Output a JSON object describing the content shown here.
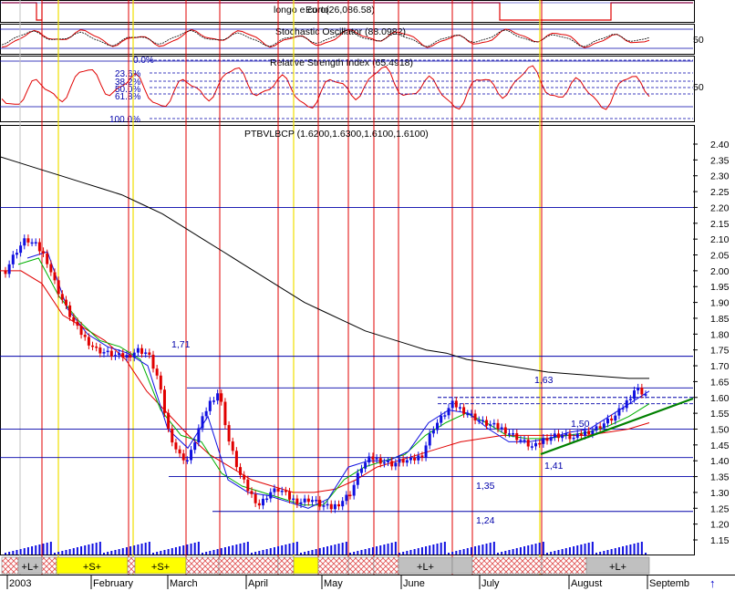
{
  "panels": {
    "top_label": "longo e corto",
    "top_label_overlay": "Euro(26,086.58)",
    "stoch_label": "Stochastic Oscillator (88.0982)",
    "stoch_tick": "50",
    "rsi_label": "Relative Strength Index (65.4918)",
    "rsi_tick": "50",
    "fib_levels": [
      "0.0%",
      "23.6%",
      "38.2%",
      "50.0%",
      "61.8%",
      "100.0%"
    ],
    "price_label": "PTBVLBCP (1.6200,1.6300,1.6100,1.6100)"
  },
  "annotations": {
    "a171": "1,71",
    "a163": "1,63",
    "a150": "1,50",
    "a141": "1,41",
    "a135": "1,35",
    "a124": "1,24"
  },
  "signals": [
    {
      "label": "+L+"
    },
    {
      "label": "+S+"
    },
    {
      "label": "+S+"
    },
    {
      "label": "+L+"
    },
    {
      "label": "+L+"
    }
  ],
  "month_labels": [
    "2003",
    "February",
    "March",
    "April",
    "May",
    "June",
    "July",
    "August",
    "Septemb"
  ],
  "colors": {
    "price_up": "#1010e0",
    "price_down": "#e00000",
    "ma_long": "#000000",
    "ma_red": "#e00000",
    "ma_green": "#00b000",
    "ma_blue": "#1010e0",
    "trend_green": "#008000",
    "gridline": "#0000aa",
    "signal_yellow": "#ffff00",
    "signal_grey": "#c0c0c0",
    "signal_hatch": "#ffb0b0",
    "arrow": "#0000cc"
  },
  "chart_data": {
    "type": "line",
    "title": "PTBVLBCP (1.6200,1.6300,1.6100,1.6100)",
    "ylim": [
      1.1,
      2.46
    ],
    "y_ticks": [
      "2.40",
      "2.35",
      "2.30",
      "2.25",
      "2.20",
      "2.15",
      "2.10",
      "2.05",
      "2.00",
      "1.95",
      "1.90",
      "1.85",
      "1.80",
      "1.75",
      "1.70",
      "1.65",
      "1.60",
      "1.55",
      "1.50",
      "1.45",
      "1.40",
      "1.35",
      "1.30",
      "1.25",
      "1.20",
      "1.15"
    ],
    "horizontal_levels": [
      2.2,
      1.73,
      1.63,
      1.6,
      1.58,
      1.5,
      1.41,
      1.35,
      1.24
    ],
    "series": [
      {
        "name": "PTBVLBCP",
        "values": [
          2.0,
          2.06,
          2.1,
          2.08,
          2.04,
          1.95,
          1.88,
          1.82,
          1.78,
          1.75,
          1.74,
          1.73,
          1.73,
          1.75,
          1.74,
          1.66,
          1.5,
          1.42,
          1.4,
          1.5,
          1.58,
          1.62,
          1.46,
          1.36,
          1.3,
          1.26,
          1.3,
          1.31,
          1.28,
          1.27,
          1.28,
          1.26,
          1.25,
          1.27,
          1.3,
          1.38,
          1.41,
          1.4,
          1.39,
          1.4,
          1.4,
          1.42,
          1.5,
          1.54,
          1.58,
          1.56,
          1.54,
          1.52,
          1.51,
          1.5,
          1.48,
          1.46,
          1.44,
          1.47,
          1.48,
          1.48,
          1.47,
          1.49,
          1.5,
          1.52,
          1.54,
          1.58,
          1.63,
          1.61
        ]
      },
      {
        "values": [
          2.36,
          2.34,
          2.32,
          2.3,
          2.28,
          2.26,
          2.24,
          2.21,
          2.18,
          2.14,
          2.1,
          2.06,
          2.02,
          1.98,
          1.94,
          1.9,
          1.87,
          1.84,
          1.81,
          1.79,
          1.77,
          1.75,
          1.74,
          1.72,
          1.71,
          1.7,
          1.69,
          1.68,
          1.675,
          1.67,
          1.665,
          1.66,
          1.66
        ]
      },
      {
        "values": [
          2.0,
          2.0,
          1.96,
          1.86,
          1.82,
          1.78,
          1.72,
          1.62,
          1.55,
          1.48,
          1.42,
          1.38,
          1.34,
          1.32,
          1.3,
          1.3,
          1.31,
          1.34,
          1.38,
          1.4,
          1.42,
          1.44,
          1.46,
          1.47,
          1.48,
          1.48,
          1.48,
          1.48,
          1.48,
          1.49,
          1.5,
          1.52
        ]
      },
      {
        "values": [
          2.02,
          2.04,
          1.92,
          1.84,
          1.78,
          1.76,
          1.72,
          1.56,
          1.48,
          1.46,
          1.36,
          1.32,
          1.3,
          1.28,
          1.26,
          1.26,
          1.34,
          1.38,
          1.4,
          1.42,
          1.48,
          1.52,
          1.55,
          1.52,
          1.48,
          1.47,
          1.47,
          1.48,
          1.49,
          1.51,
          1.54,
          1.58
        ]
      },
      {
        "values": [
          2.04,
          2.06,
          1.88,
          1.8,
          1.76,
          1.74,
          1.7,
          1.5,
          1.44,
          1.54,
          1.34,
          1.3,
          1.29,
          1.27,
          1.25,
          1.28,
          1.38,
          1.4,
          1.4,
          1.43,
          1.52,
          1.56,
          1.55,
          1.5,
          1.46,
          1.46,
          1.47,
          1.49,
          1.5,
          1.54,
          1.58,
          1.62
        ]
      }
    ]
  }
}
